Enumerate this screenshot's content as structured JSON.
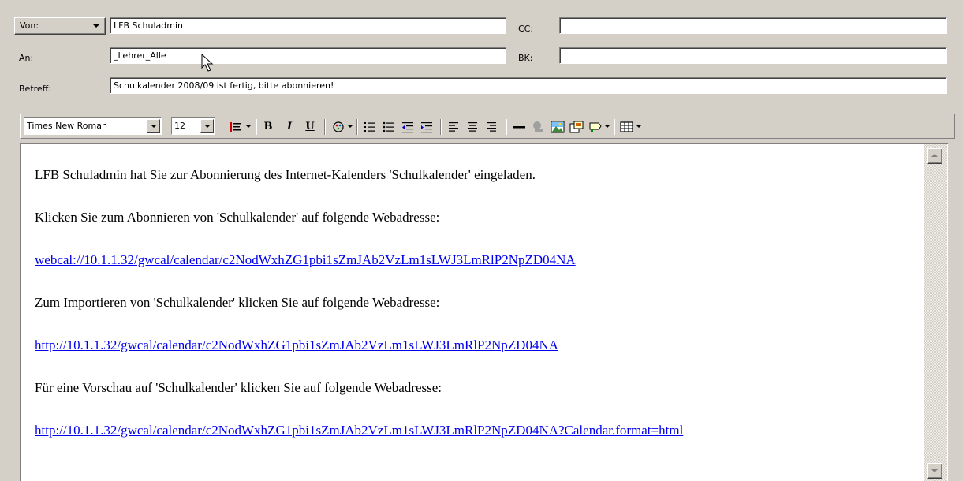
{
  "header": {
    "von_label": "Von:",
    "von_value": "LFB Schuladmin",
    "an_label": "An:",
    "an_value": "_Lehrer_Alle",
    "cc_label": "CC:",
    "cc_value": "",
    "bk_label": "BK:",
    "bk_value": "",
    "betreff_label": "Betreff:",
    "betreff_value": "Schulkalender 2008/09 ist fertig, bitte abonnieren!"
  },
  "toolbar": {
    "font_name": "Times New Roman",
    "font_size": "12",
    "bold_label": "B",
    "italic_label": "I",
    "underline_label": "U"
  },
  "body": {
    "line1": "LFB Schuladmin hat Sie zur Abonnierung des Internet-Kalenders 'Schulkalender' eingeladen.",
    "line2": "Klicken Sie zum Abonnieren von 'Schulkalender' auf folgende Webadresse:",
    "link1": "webcal://10.1.1.32/gwcal/calendar/c2NodWxhZG1pbi1sZmJAb2VzLm1sLWJ3LmRlP2NpZD04NA",
    "line3": "Zum Importieren von 'Schulkalender' klicken Sie auf folgende Webadresse:",
    "link2": "http://10.1.1.32/gwcal/calendar/c2NodWxhZG1pbi1sZmJAb2VzLm1sLWJ3LmRlP2NpZD04NA",
    "line4": "Für eine Vorschau auf 'Schulkalender' klicken Sie auf folgende Webadresse:",
    "link3": "http://10.1.1.32/gwcal/calendar/c2NodWxhZG1pbi1sZmJAb2VzLm1sLWJ3LmRlP2NpZD04NA?Calendar.format=html"
  },
  "colors": {
    "window_bg": "#d4d0c8",
    "link": "#0000ee"
  }
}
